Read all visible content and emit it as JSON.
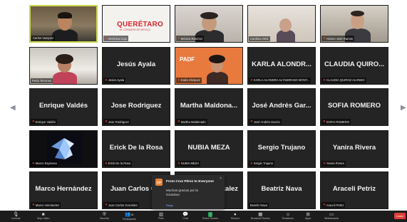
{
  "tiles": [
    {
      "key": "t1",
      "display_name": "",
      "label": "Carlos Vazquez"
    },
    {
      "key": "t2",
      "display_name": "",
      "label": "Verónica Ceja"
    },
    {
      "key": "t3",
      "display_name": "",
      "label": "Mónica Ramírez"
    },
    {
      "key": "t4",
      "display_name": "",
      "label": "Carolina Ortiz"
    },
    {
      "key": "t5",
      "display_name": "",
      "label": "Alonso José Ramos"
    },
    {
      "key": "t6",
      "display_name": "",
      "label": "Perla Terrones"
    },
    {
      "key": "t7",
      "display_name": "Jesús Ayala",
      "label": "Jesús Ayala"
    },
    {
      "key": "t8",
      "display_name": "",
      "label": "Karla Vázquez"
    },
    {
      "key": "t9",
      "display_name": "KARLA ALONDR...",
      "label": "KARLA ALONDRA ALTAMIRANO MONT..."
    },
    {
      "key": "t10",
      "display_name": "CLAUDIA QUIRO...",
      "label": "CLAUDIA QUIROZ ALONSO"
    },
    {
      "key": "t11",
      "display_name": "Enrique Valdés",
      "label": "Enrique Valdés"
    },
    {
      "key": "t12",
      "display_name": "Jose Rodriguez",
      "label": "Jose Rodriguez"
    },
    {
      "key": "t13",
      "display_name": "Martha Maldona...",
      "label": "Martha Maldonado"
    },
    {
      "key": "t14",
      "display_name": "José Andrés Gar...",
      "label": "José Andrés García"
    },
    {
      "key": "t15",
      "display_name": "SOFIA ROMERO",
      "label": "SOFIA ROMERO"
    },
    {
      "key": "t16",
      "display_name": "",
      "label": "Marco Espinosa"
    },
    {
      "key": "t17",
      "display_name": "Erick De la Rosa",
      "label": "Erick De la Rosa"
    },
    {
      "key": "t18",
      "display_name": "NUBIA MEZA",
      "label": "NUBIA MEZA"
    },
    {
      "key": "t19",
      "display_name": "Sergio Trujano",
      "label": "Sergio Trujano"
    },
    {
      "key": "t20",
      "display_name": "Yanira Rivera",
      "label": "Yanira Rivera"
    },
    {
      "key": "t21",
      "display_name": "Marco Hernández",
      "label": "Marco Hernández"
    },
    {
      "key": "t22",
      "display_name": "Juan Carlos G...",
      "label": "Juan Carlos González"
    },
    {
      "key": "t23",
      "display_name": "...zalez",
      "label": ""
    },
    {
      "key": "t24",
      "display_name": "Beatriz Nava",
      "label": "Beatriz Nava"
    },
    {
      "key": "t25",
      "display_name": "Araceli Petriz",
      "label": "Araceli Petriz"
    }
  ],
  "logos": {
    "queretaro": "QUERÉTARO",
    "queretaro_sub": "EL CORAZÓN DE MÉXICO",
    "padf": "PADF"
  },
  "chat_toast": {
    "avatar": "CP",
    "from": "From Cruz Pérez to Everyone",
    "message": "Muchas gracias por la iniciativa!",
    "close": "×",
    "reply": "Reply"
  },
  "toolbar": {
    "unmute": "Unmute",
    "stop_video": "Stop Video",
    "security": "Security",
    "participants": "Participants",
    "participants_count": "26",
    "polls": "Polls",
    "chat": "Chat",
    "share_screen": "Share Screen",
    "record": "Record",
    "breakout_rooms": "Breakout Rooms",
    "reactions": "Reactions",
    "apps": "Apps",
    "whiteboards": "Whiteboards",
    "leave": "Leave"
  },
  "colors": {
    "active_speaker": "#c9d64a",
    "tile_bg": "#242424",
    "leave": "#e03e36",
    "share": "#23a35a"
  }
}
